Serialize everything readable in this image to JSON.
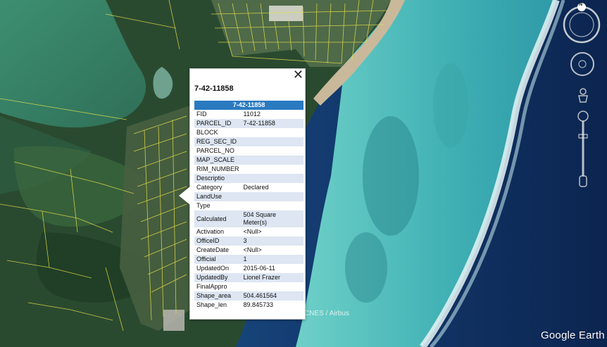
{
  "popup": {
    "title": "7-42-11858",
    "header": "7-42-11858",
    "close_icon": "close-icon",
    "rows": [
      {
        "key": "FID",
        "value": "11012"
      },
      {
        "key": "PARCEL_ID",
        "value": "7-42-11858"
      },
      {
        "key": "BLOCK",
        "value": ""
      },
      {
        "key": "REG_SEC_ID",
        "value": ""
      },
      {
        "key": "PARCEL_NO",
        "value": ""
      },
      {
        "key": "MAP_SCALE",
        "value": ""
      },
      {
        "key": "RIM_NUMBER",
        "value": ""
      },
      {
        "key": "Descriptio",
        "value": ""
      },
      {
        "key": "Category",
        "value": "Declared"
      },
      {
        "key": "LandUse",
        "value": ""
      },
      {
        "key": "Type",
        "value": ""
      },
      {
        "key": "Calculated",
        "value": "504 Square Meter(s)"
      },
      {
        "key": "Activation",
        "value": "<Null>"
      },
      {
        "key": "OfficeID",
        "value": "3"
      },
      {
        "key": "CreateDate",
        "value": "<Null>"
      },
      {
        "key": "Official",
        "value": "1"
      },
      {
        "key": "UpdatedOn",
        "value": "2015-06-11"
      },
      {
        "key": "UpdatedBy",
        "value": "Lionel Frazer"
      },
      {
        "key": "FinalAppro",
        "value": ""
      },
      {
        "key": "Shape_area",
        "value": "504.461564"
      },
      {
        "key": "Shape_len",
        "value": "89.845733"
      }
    ]
  },
  "map": {
    "imagery_credit": "CNES / Airbus",
    "logo": "Google Earth",
    "compass_label": "N",
    "colors": {
      "lagoon": "#3b8a6f",
      "vegetation": "#22432b",
      "reef_shallow": "#5fc6c2",
      "ocean_deep": "#0f2d57",
      "parcel_lines": "#e8e04a",
      "popup_header": "#2a7ac0"
    }
  },
  "controls": {
    "compass_icon": "compass-icon",
    "look_joystick_icon": "look-joystick-icon",
    "move_joystick_icon": "move-joystick-icon",
    "street_view_icon": "pegman-icon",
    "zoom_slider_icon": "zoom-slider-icon"
  }
}
